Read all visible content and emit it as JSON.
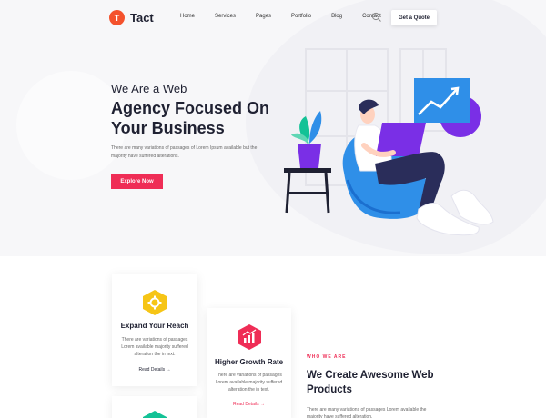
{
  "header": {
    "logo_mark": "T",
    "logo_text": "Tact",
    "nav": [
      "Home",
      "Services",
      "Pages",
      "Portfolio",
      "Blog",
      "Contact"
    ],
    "search_icon": "search-icon",
    "quote_button": "Get a Quote"
  },
  "hero": {
    "kicker": "We Are a Web",
    "title": "Agency Focused On Your Business",
    "description": "There are many variations of passages of Lorem Ipsum available but the majority have suffered alterations.",
    "button": "Explore Now"
  },
  "features": [
    {
      "icon": "gear-icon",
      "title": "Expand Your Reach",
      "description": "There are variations of passages Lorem available majority suffered alteration the in text.",
      "link": "Read Details",
      "color": "#f6c516"
    },
    {
      "icon": "chart-icon",
      "title": "Higher Growth Rate",
      "description": "There are variations of passages Lorem available majority suffered alteration the in text.",
      "link": "Read Details",
      "color": "#ef2d56"
    }
  ],
  "about": {
    "eyebrow": "WHO WE ARE",
    "title": "We Create Awesome Web Products",
    "description": "There are many variations of passages Lorem available the majority have suffered alteration."
  },
  "colors": {
    "accent": "#ef2d56",
    "logo": "#f4522d",
    "yellow": "#f6c516",
    "green": "#13c296",
    "blue": "#2f8fe8",
    "purple": "#7a2fe6"
  }
}
